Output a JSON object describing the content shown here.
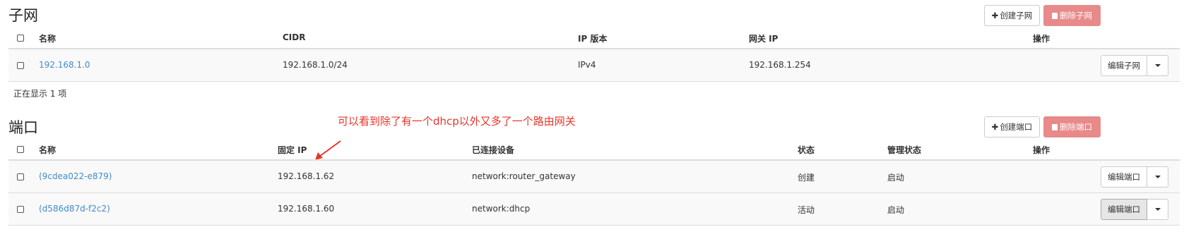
{
  "subnets": {
    "title": "子网",
    "create_label": "创建子网",
    "delete_label": "删除子网",
    "columns": [
      "名称",
      "CIDR",
      "IP 版本",
      "网关 IP",
      "操作"
    ],
    "rows": [
      {
        "name": "192.168.1.0",
        "cidr": "192.168.1.0/24",
        "ip_version": "IPv4",
        "gateway": "192.168.1.254",
        "action": "编辑子网"
      }
    ],
    "count_text": "正在显示 1 项"
  },
  "ports": {
    "title": "端口",
    "create_label": "创建端口",
    "delete_label": "删除端口",
    "columns": [
      "名称",
      "固定 IP",
      "已连接设备",
      "状态",
      "管理状态",
      "操作"
    ],
    "rows": [
      {
        "name": "(9cdea022-e879)",
        "fixed_ip": "192.168.1.62",
        "device": "network:router_gateway",
        "status": "创建",
        "admin_state": "启动",
        "action": "编辑端口"
      },
      {
        "name": "(d586d87d-f2c2)",
        "fixed_ip": "192.168.1.60",
        "device": "network:dhcp",
        "status": "活动",
        "admin_state": "启动",
        "action": "编辑端口"
      }
    ]
  },
  "annotation": "可以看到除了有一个dhcp以外又多了一个路由网关",
  "colors": {
    "link": "#428bca",
    "danger": "#e8898a",
    "annotation": "#e8352b"
  }
}
